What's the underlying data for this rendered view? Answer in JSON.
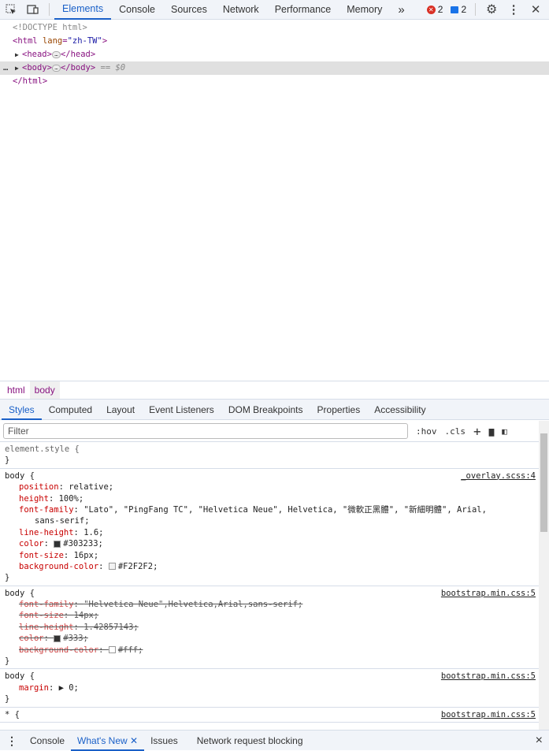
{
  "toolbar": {
    "tabs": [
      "Elements",
      "Console",
      "Sources",
      "Network",
      "Performance",
      "Memory"
    ],
    "more": "»",
    "errors": "2",
    "messages": "2"
  },
  "dom": {
    "l1": "<!DOCTYPE html>",
    "l2_tag": "<html ",
    "l2_attr": "lang",
    "l2_val": "\"zh-TW\"",
    "l2_end": ">",
    "head_open": "<head>",
    "head_close": "</head>",
    "body_open": "<body>",
    "body_close": "</body>",
    "eq": " == $0",
    "html_close": "</html>",
    "ellipsis": "…"
  },
  "breadcrumbs": [
    "html",
    "body"
  ],
  "subtabs": [
    "Styles",
    "Computed",
    "Layout",
    "Event Listeners",
    "DOM Breakpoints",
    "Properties",
    "Accessibility"
  ],
  "filter": {
    "placeholder": "Filter",
    "hov": ":hov",
    "cls": ".cls"
  },
  "rules": [
    {
      "selector": "element.style {",
      "source": "",
      "props": []
    },
    {
      "selector": "body {",
      "source": "_overlay.scss:4",
      "props": [
        {
          "name": "position",
          "value": "relative;"
        },
        {
          "name": "height",
          "value": "100%;"
        },
        {
          "name": "font-family",
          "value": "\"Lato\", \"PingFang TC\", \"Helvetica Neue\", Helvetica, \"微軟正黑體\", \"新細明體\", Arial,",
          "cont": "sans-serif;"
        },
        {
          "name": "line-height",
          "value": "1.6;"
        },
        {
          "name": "color",
          "value": "#303233;",
          "swatch": "#303233"
        },
        {
          "name": "font-size",
          "value": "16px;"
        },
        {
          "name": "background-color",
          "value": "#F2F2F2;",
          "swatch": "#F2F2F2"
        }
      ]
    },
    {
      "selector": "body {",
      "source": "bootstrap.min.css:5",
      "props": [
        {
          "name": "font-family",
          "value": "\"Helvetica Neue\",Helvetica,Arial,sans-serif;",
          "strike": true
        },
        {
          "name": "font-size",
          "value": "14px;",
          "strike": true
        },
        {
          "name": "line-height",
          "value": "1.42857143;",
          "strike": true
        },
        {
          "name": "color",
          "value": "#333;",
          "swatch": "#333333",
          "strike": true
        },
        {
          "name": "background-color",
          "value": "#fff;",
          "swatch": "#ffffff",
          "strike": true
        }
      ]
    },
    {
      "selector": "body {",
      "source": "bootstrap.min.css:5",
      "props": [
        {
          "name": "margin",
          "value": "▶ 0;"
        }
      ]
    },
    {
      "selector": "* {",
      "source": "bootstrap.min.css:5",
      "props": [],
      "open": true
    }
  ],
  "drawer": {
    "tabs": [
      "Console",
      "What's New",
      "Issues",
      "Network request blocking"
    ],
    "close": "×"
  }
}
